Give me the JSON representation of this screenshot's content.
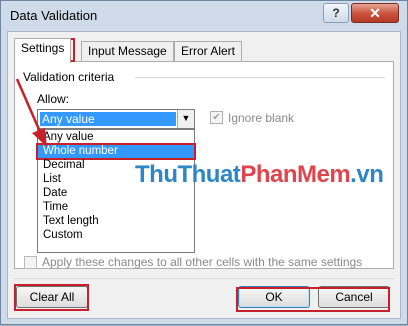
{
  "window": {
    "title": "Data Validation",
    "help_label": "?",
    "close_label": "✕"
  },
  "tabs": [
    {
      "label": "Settings"
    },
    {
      "label": "Input Message"
    },
    {
      "label": "Error Alert"
    }
  ],
  "settings": {
    "group_label": "Validation criteria",
    "allow_label": "Allow:",
    "allow_value": "Any value",
    "ignore_blank_label": "Ignore blank",
    "ignore_blank_checked": true,
    "options": [
      "Any value",
      "Whole number",
      "Decimal",
      "List",
      "Date",
      "Time",
      "Text length",
      "Custom"
    ],
    "highlighted_option": "Whole number"
  },
  "apply_all_label": "Apply these changes to all other cells with the same settings",
  "buttons": {
    "clear": "Clear All",
    "ok": "OK",
    "cancel": "Cancel"
  },
  "watermark": {
    "part1": "ThuThuat",
    "part2": "PhanMem",
    "part3": ".vn"
  },
  "colors": {
    "highlight": "#3399ff",
    "annotation_red": "#c8202a"
  }
}
